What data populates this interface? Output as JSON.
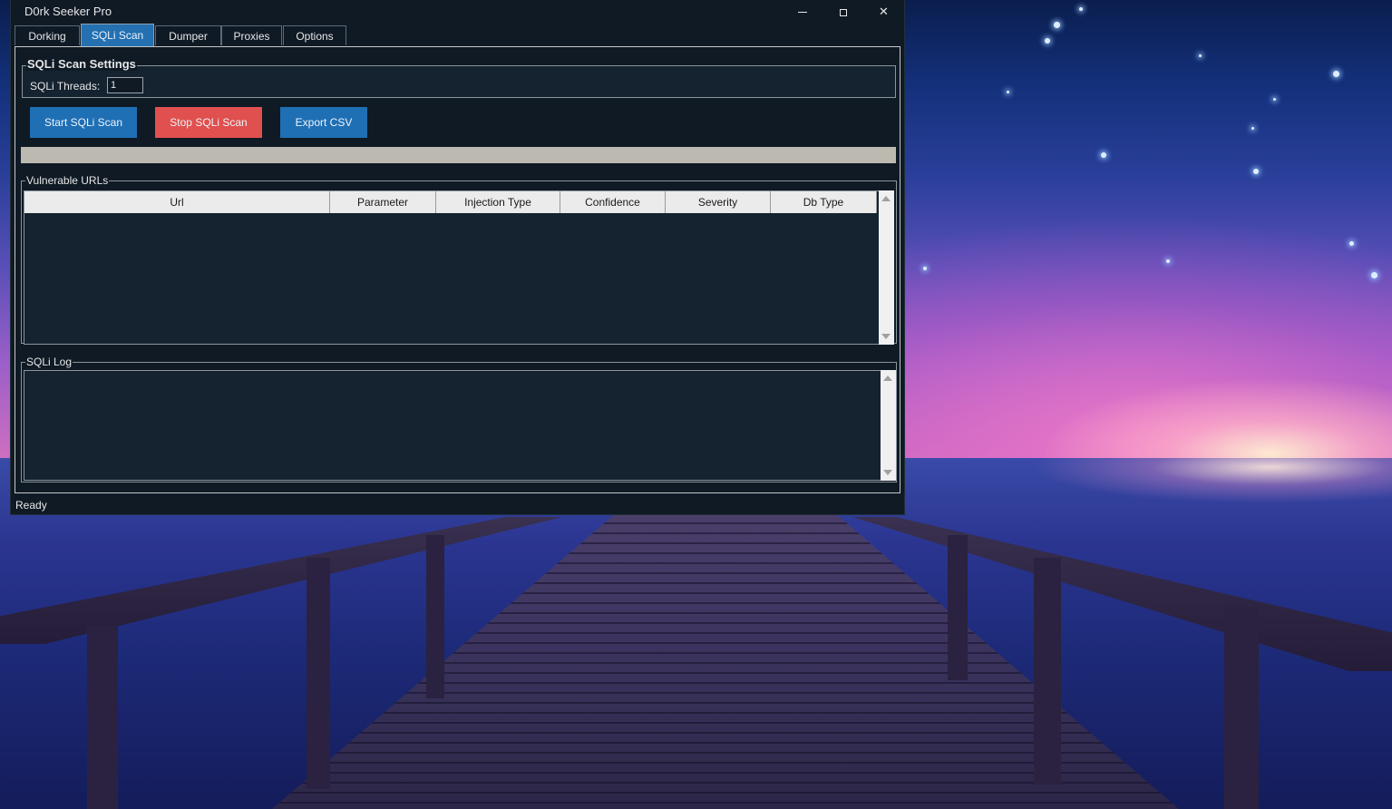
{
  "window": {
    "title": "D0rk Seeker Pro",
    "controls": {
      "minimize": "minimize-icon",
      "maximize": "maximize-icon",
      "close": "close-icon"
    }
  },
  "tabs": [
    {
      "label": "Dorking",
      "active": false
    },
    {
      "label": "SQLi Scan",
      "active": true
    },
    {
      "label": "Dumper",
      "active": false
    },
    {
      "label": "Proxies",
      "active": false
    },
    {
      "label": "Options",
      "active": false
    }
  ],
  "settings": {
    "title": "SQLi Scan Settings",
    "threads_label": "SQLi Threads:",
    "threads_value": "1"
  },
  "buttons": {
    "start": "Start SQLi Scan",
    "stop": "Stop SQLi Scan",
    "export": "Export CSV"
  },
  "colors": {
    "start_button": "#1f6fb5",
    "stop_button": "#e0504e",
    "export_button": "#1f6fb5",
    "active_tab": "#2470b0",
    "window_bg": "#0f1a25"
  },
  "progress": {
    "value": 0
  },
  "vulnerable": {
    "title": "Vulnerable URLs",
    "columns": [
      "Url",
      "Parameter",
      "Injection Type",
      "Confidence",
      "Severity",
      "Db Type"
    ],
    "rows": []
  },
  "log": {
    "title": "SQLi Log",
    "content": ""
  },
  "status": {
    "text": "Ready"
  }
}
